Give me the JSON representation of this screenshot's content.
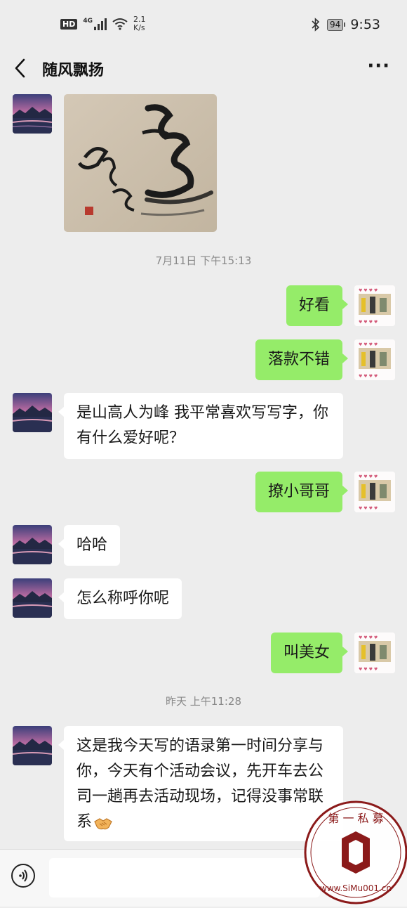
{
  "status_bar": {
    "hd_badge": "HD",
    "network_type": "4G",
    "net_speed_value": "2.1",
    "net_speed_unit": "K/s",
    "battery_level": "94",
    "time": "9:53"
  },
  "header": {
    "title": "随风飘扬",
    "back_icon": "chevron-left-icon",
    "more_icon": "more-dots-icon"
  },
  "timestamps": {
    "t1": "7月11日 下午15:13",
    "t2": "昨天 上午11:28"
  },
  "messages": [
    {
      "from": "contact",
      "type": "image",
      "content": "calligraphy artwork"
    },
    {
      "from": "me",
      "type": "text",
      "text": "好看"
    },
    {
      "from": "me",
      "type": "text",
      "text": "落款不错"
    },
    {
      "from": "contact",
      "type": "text",
      "text": "是山高人为峰 我平常喜欢写写字，你有什么爱好呢？"
    },
    {
      "from": "me",
      "type": "text",
      "text": "撩小哥哥"
    },
    {
      "from": "contact",
      "type": "text",
      "text": "哈哈"
    },
    {
      "from": "contact",
      "type": "text",
      "text": "怎么称呼你呢"
    },
    {
      "from": "me",
      "type": "text",
      "text": "叫美女"
    },
    {
      "from": "contact",
      "type": "text",
      "text": "这是我今天写的语录第一时间分享与你，今天有个活动会议，先开车去公司一趟再去活动现场，记得没事常联系",
      "trailing_emoji": "handshake-emoji"
    }
  ],
  "composer": {
    "voice_icon": "voice-icon",
    "input_value": ""
  },
  "watermark": {
    "top_text": "第 一 私 募",
    "bottom_text": "www.SiMu001.cn"
  },
  "colors": {
    "background": "#ededed",
    "bubble_in": "#ffffff",
    "bubble_out": "#95ec69",
    "watermark": "#8b1a1a"
  }
}
